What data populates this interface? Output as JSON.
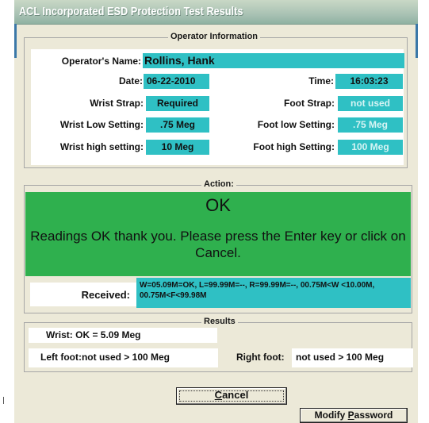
{
  "window": {
    "title": "ACL Incorporated ESD Protection Test Results"
  },
  "operator_info": {
    "group_label": "Operator Information",
    "name_label": "Operator's Name:",
    "name_value": "Rollins, Hank",
    "date_label": "Date:",
    "date_value": "06-22-2010",
    "time_label": "Time:",
    "time_value": "16:03:23",
    "wrist_strap_label": "Wrist Strap:",
    "wrist_strap_value": "Required",
    "foot_strap_label": "Foot Strap:",
    "foot_strap_value": "not used",
    "wrist_low_label": "Wrist Low Setting:",
    "wrist_low_value": ".75 Meg",
    "foot_low_label": "Foot low Setting:",
    "foot_low_value": ".75 Meg",
    "wrist_high_label": "Wrist high setting:",
    "wrist_high_value": "10 Meg",
    "foot_high_label": "Foot high Setting:",
    "foot_high_value": "100 Meg"
  },
  "action": {
    "group_label": "Action:",
    "status": "OK",
    "message": "Readings OK thank you.  Please press the Enter key or click on Cancel.",
    "received_label": "Received:",
    "received_value": "W=05.09M=OK, L=99.99M=--, R=99.99M=--, 00.75M<W <10.00M, 00.75M<F<99.98M"
  },
  "results": {
    "group_label": "Results",
    "wrist": "Wrist:  OK    = 5.09 Meg",
    "left_foot": "Left foot:not used > 100 Meg",
    "right_foot_label": "Right foot:",
    "right_foot_value": "not used > 100 Meg"
  },
  "buttons": {
    "cancel_prefix": "",
    "cancel_underlined": "C",
    "cancel_rest": "ancel",
    "modify_prefix": "Modify ",
    "modify_underlined": "P",
    "modify_rest": "assword"
  },
  "colors": {
    "field_teal": "#2fc0c4",
    "action_green": "#2fb04e",
    "dialog_face": "#ece9d8"
  }
}
